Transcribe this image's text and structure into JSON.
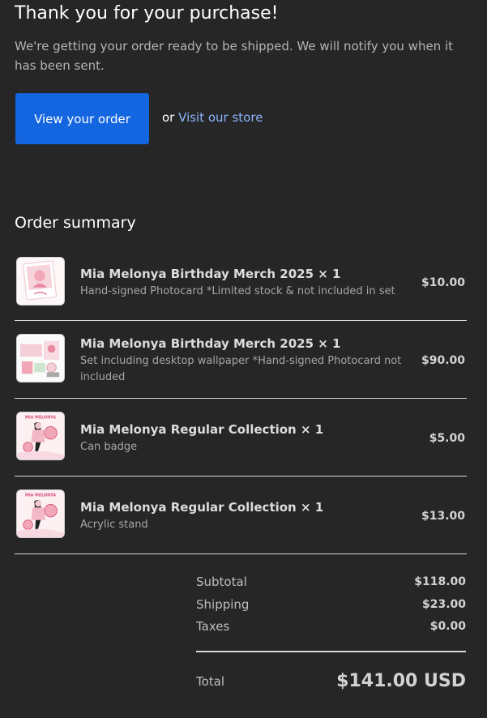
{
  "header": {
    "title": "Thank you for your purchase!",
    "subtitle": "We're getting your order ready to be shipped. We will notify you when it has been sent.",
    "view_order_label": "View your order",
    "or_text": "or",
    "visit_store_label": "Visit our store"
  },
  "summary": {
    "title": "Order summary",
    "items": [
      {
        "name": "Mia Melonya Birthday Merch 2025 × 1",
        "description": "Hand-signed Photocard *Limited stock & not included in set",
        "price": "$10.00",
        "thumbnail_icon": "photocard-thumbnail"
      },
      {
        "name": "Mia Melonya Birthday Merch 2025 × 1",
        "description": "Set including desktop wallpaper *Hand-signed Photocard not included",
        "price": "$90.00",
        "thumbnail_icon": "merch-set-thumbnail"
      },
      {
        "name": "Mia Melonya Regular Collection × 1",
        "description": "Can badge",
        "price": "$5.00",
        "thumbnail_icon": "can-badge-thumbnail",
        "thumbnail_text": "MIA MELONYA"
      },
      {
        "name": "Mia Melonya Regular Collection × 1",
        "description": "Acrylic stand",
        "price": "$13.00",
        "thumbnail_icon": "acrylic-stand-thumbnail",
        "thumbnail_text": "MIA MELONYA"
      }
    ]
  },
  "totals": {
    "subtotal_label": "Subtotal",
    "subtotal_value": "$118.00",
    "shipping_label": "Shipping",
    "shipping_value": "$23.00",
    "taxes_label": "Taxes",
    "taxes_value": "$0.00",
    "total_label": "Total",
    "total_value": "$141.00 USD"
  },
  "colors": {
    "background": "#262626",
    "primary_button": "#1466e0",
    "link": "#8bb4ff"
  }
}
